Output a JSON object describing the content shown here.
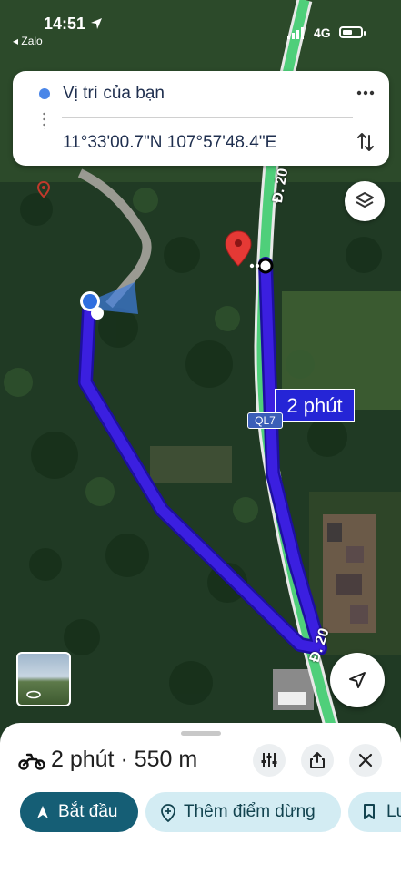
{
  "status_bar": {
    "time": "14:51",
    "back_app": "◂ Zalo",
    "network": "4G"
  },
  "route_card": {
    "origin": "Vị trí của bạn",
    "destination": "11°33'00.7\"N 107°57'48.4\"E"
  },
  "map": {
    "duration_label": "2 phút",
    "road_badge": "QL7",
    "road_label_top": "Đ. 20",
    "road_label_bottom": "Đ. 20",
    "colors": {
      "route": "#3b1fe0",
      "route_outline": "#1d0fa0",
      "road": "#4fcf7a",
      "pin": "#e53935"
    }
  },
  "sheet": {
    "summary": "2 phút · 550 m",
    "start_label": "Bắt đầu",
    "add_stop_label": "Thêm điểm dừng",
    "save_label": "Lưu"
  }
}
